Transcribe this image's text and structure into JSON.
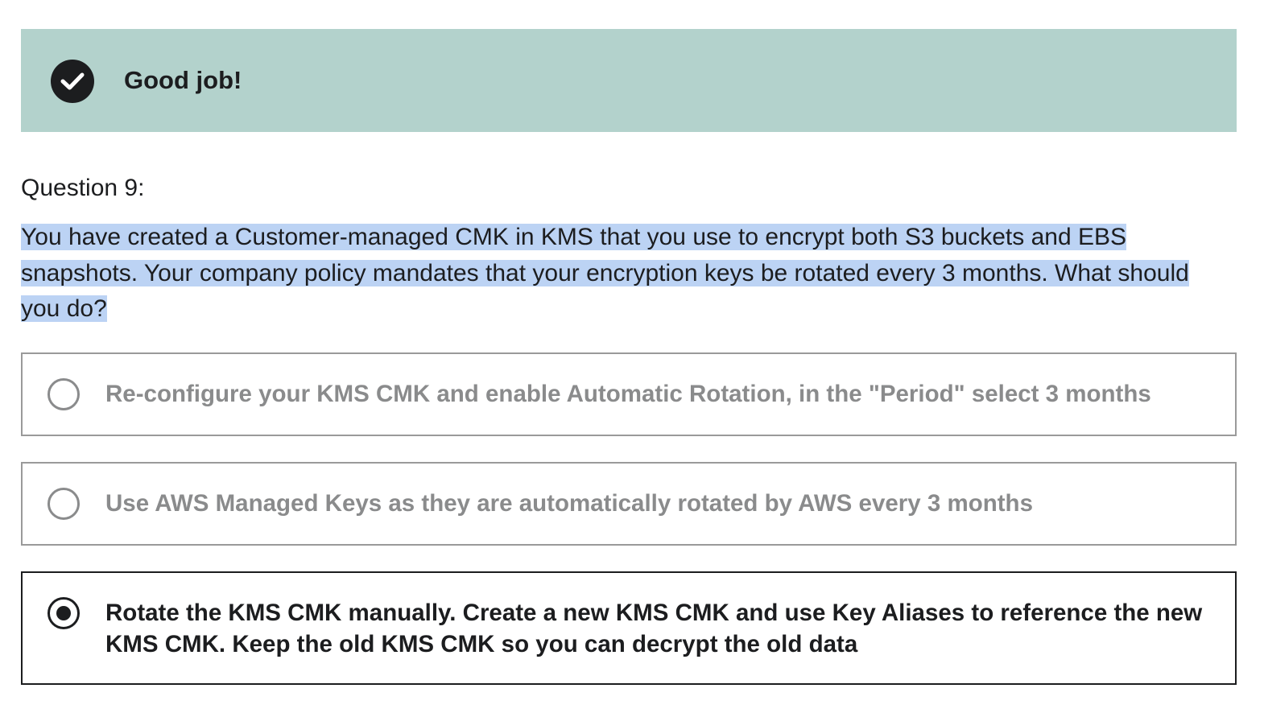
{
  "banner": {
    "message": "Good job!",
    "icon": "check-circle-icon",
    "background_color": "#b3d2cc"
  },
  "question": {
    "label": "Question 9:",
    "text": "You have created a Customer-managed CMK in KMS that you use to encrypt both S3 buckets and EBS snapshots. Your company policy mandates that your encryption keys be rotated every 3 months. What should you do?",
    "highlight_color": "#bcd3f4"
  },
  "options": [
    {
      "label": "Re-configure your KMS CMK and enable Automatic Rotation, in the \"Period\" select 3 months",
      "selected": false
    },
    {
      "label": "Use AWS Managed Keys as they are automatically rotated by AWS every 3 months",
      "selected": false
    },
    {
      "label": "Rotate the KMS CMK manually. Create a new KMS CMK and use Key Aliases to reference the new KMS CMK. Keep the old KMS CMK so you can decrypt the old data",
      "selected": true
    }
  ]
}
